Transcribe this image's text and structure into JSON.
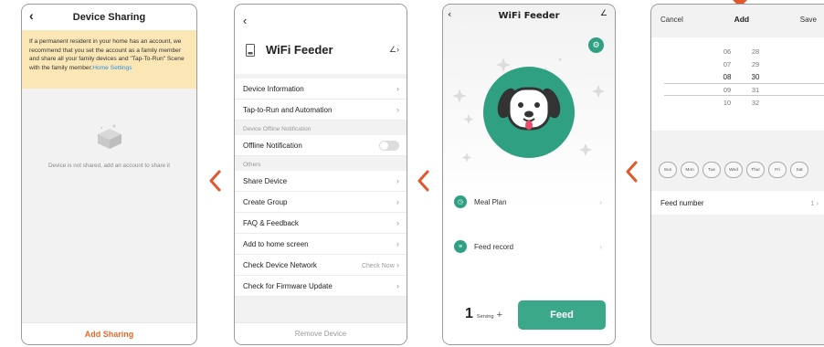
{
  "screen1": {
    "title": "Device Sharing",
    "notice_text": "If a permanent resident in your home has an account, we recommend that you set the account as a family member and share all your family devices and \"Tap-To-Run\" Scene with the family member.",
    "notice_link": "Home Settings",
    "empty_text": "Device is not shared, add an account to share it",
    "add_button": "Add Sharing"
  },
  "screen2": {
    "device_name": "WiFi Feeder",
    "items_top": [
      {
        "label": "Device Information"
      },
      {
        "label": "Tap-to-Run and Automation"
      }
    ],
    "offline_section": "Device Offline Notification",
    "offline_item": "Offline Notification",
    "others_section": "Others",
    "items_others": [
      {
        "label": "Share Device",
        "right": ""
      },
      {
        "label": "Create Group",
        "right": ""
      },
      {
        "label": "FAQ & Feedback",
        "right": ""
      },
      {
        "label": "Add to home screen",
        "right": ""
      },
      {
        "label": "Check Device Network",
        "right": "Check Now"
      },
      {
        "label": "Check for Firmware Update",
        "right": ""
      }
    ],
    "remove_button": "Remove Device"
  },
  "screen3": {
    "title": "WiFi Feeder",
    "menu": [
      {
        "label": "Meal Plan"
      },
      {
        "label": "Feed record"
      }
    ],
    "serving_count": "1",
    "serving_unit": "Serving",
    "plus": "+",
    "feed_button": "Feed",
    "accent": "#2fa082"
  },
  "screen4": {
    "cancel": "Cancel",
    "title": "Add",
    "save": "Save",
    "hours": [
      "06",
      "07",
      "08",
      "09",
      "10"
    ],
    "minutes": [
      "28",
      "29",
      "30",
      "31",
      "32"
    ],
    "selected_hour": "08",
    "selected_minute": "30",
    "days": [
      "Sun",
      "Mon",
      "Tue",
      "Wed",
      "Thur",
      "Fri",
      "Sat"
    ],
    "feed_number_label": "Feed number",
    "feed_number_value": "1"
  },
  "colors": {
    "arrow": "#e2572b",
    "accent_orange": "#e8682a",
    "notice_bg": "#fbe7b6"
  }
}
